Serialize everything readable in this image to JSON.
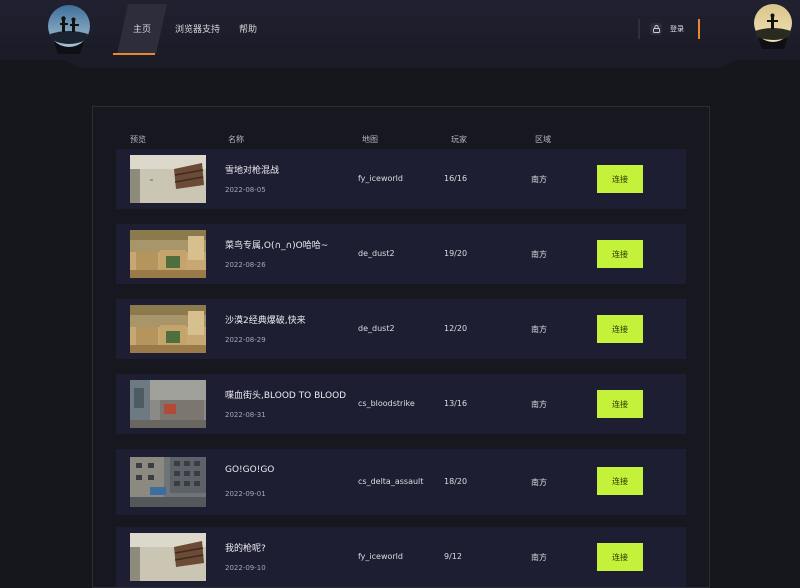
{
  "nav": {
    "items": [
      {
        "label": "主页",
        "active": true
      },
      {
        "label": "浏览器支持",
        "active": false
      },
      {
        "label": "帮助",
        "active": false
      }
    ],
    "login_label": "登录",
    "accent_color": "#e88a2c"
  },
  "table": {
    "headers": {
      "preview": "预览",
      "name": "名称",
      "map": "地图",
      "players": "玩家",
      "region": "区域"
    },
    "connect_color": "#c4f23a",
    "rows": [
      {
        "name": "雪地对枪混战",
        "date": "2022-08-05",
        "map": "fy_iceworld",
        "players": "16/16",
        "region": "南方",
        "action": "连接",
        "thumb": "snow"
      },
      {
        "name": "菜鸟专属,O(∩_∩)O哈哈~",
        "date": "2022-08-26",
        "map": "de_dust2",
        "players": "19/20",
        "region": "南方",
        "action": "连接",
        "thumb": "dust"
      },
      {
        "name": "沙漠2经典爆破,快来",
        "date": "2022-08-29",
        "map": "de_dust2",
        "players": "12/20",
        "region": "南方",
        "action": "连接",
        "thumb": "dust"
      },
      {
        "name": "喋血街头,BLOOD TO BLOOD",
        "date": "2022-08-31",
        "map": "cs_bloodstrike",
        "players": "13/16",
        "region": "南方",
        "action": "连接",
        "thumb": "blood"
      },
      {
        "name": "GO!GO!GO",
        "date": "2022-09-01",
        "map": "cs_delta_assault",
        "players": "18/20",
        "region": "南方",
        "action": "连接",
        "thumb": "delta"
      },
      {
        "name": "我的枪呢?",
        "date": "2022-09-10",
        "map": "fy_iceworld",
        "players": "9/12",
        "region": "南方",
        "action": "连接",
        "thumb": "snow"
      }
    ]
  }
}
